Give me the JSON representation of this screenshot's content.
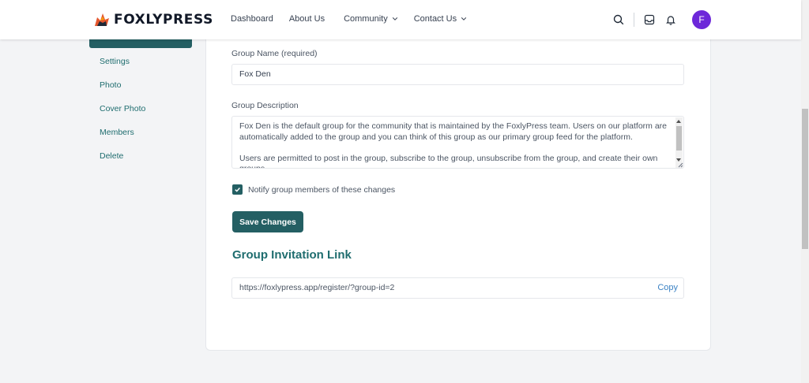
{
  "header": {
    "brand": "FOXLYPRESS",
    "nav": [
      {
        "label": "Dashboard"
      },
      {
        "label": "About Us"
      },
      {
        "label": "Community"
      },
      {
        "label": "Contact Us"
      }
    ],
    "avatar_initial": "F"
  },
  "sidebar": {
    "items": [
      {
        "label": "Settings"
      },
      {
        "label": "Photo"
      },
      {
        "label": "Cover Photo"
      },
      {
        "label": "Members"
      },
      {
        "label": "Delete"
      }
    ]
  },
  "form": {
    "group_name_label": "Group Name (required)",
    "group_name_value": "Fox Den",
    "description_label": "Group Description",
    "description_p1": "Fox Den is the default group for the community that is maintained by the FoxlyPress team. Users on our platform are automatically added to the group and you can think of this group as our primary group feed for the platform.",
    "description_p2": "Users are permitted to post in the group, subscribe to the group, unsubscribe from the group, and create their own groups.",
    "notify_label": "Notify group members of these changes",
    "notify_checked": true,
    "save_label": "Save Changes"
  },
  "invitation": {
    "title": "Group Invitation Link",
    "url": "https://foxlypress.app/register/?group-id=2",
    "copy_label": "Copy"
  },
  "colors": {
    "accent": "#245f63",
    "avatar": "#6d28d9",
    "link": "#3b82c4"
  }
}
